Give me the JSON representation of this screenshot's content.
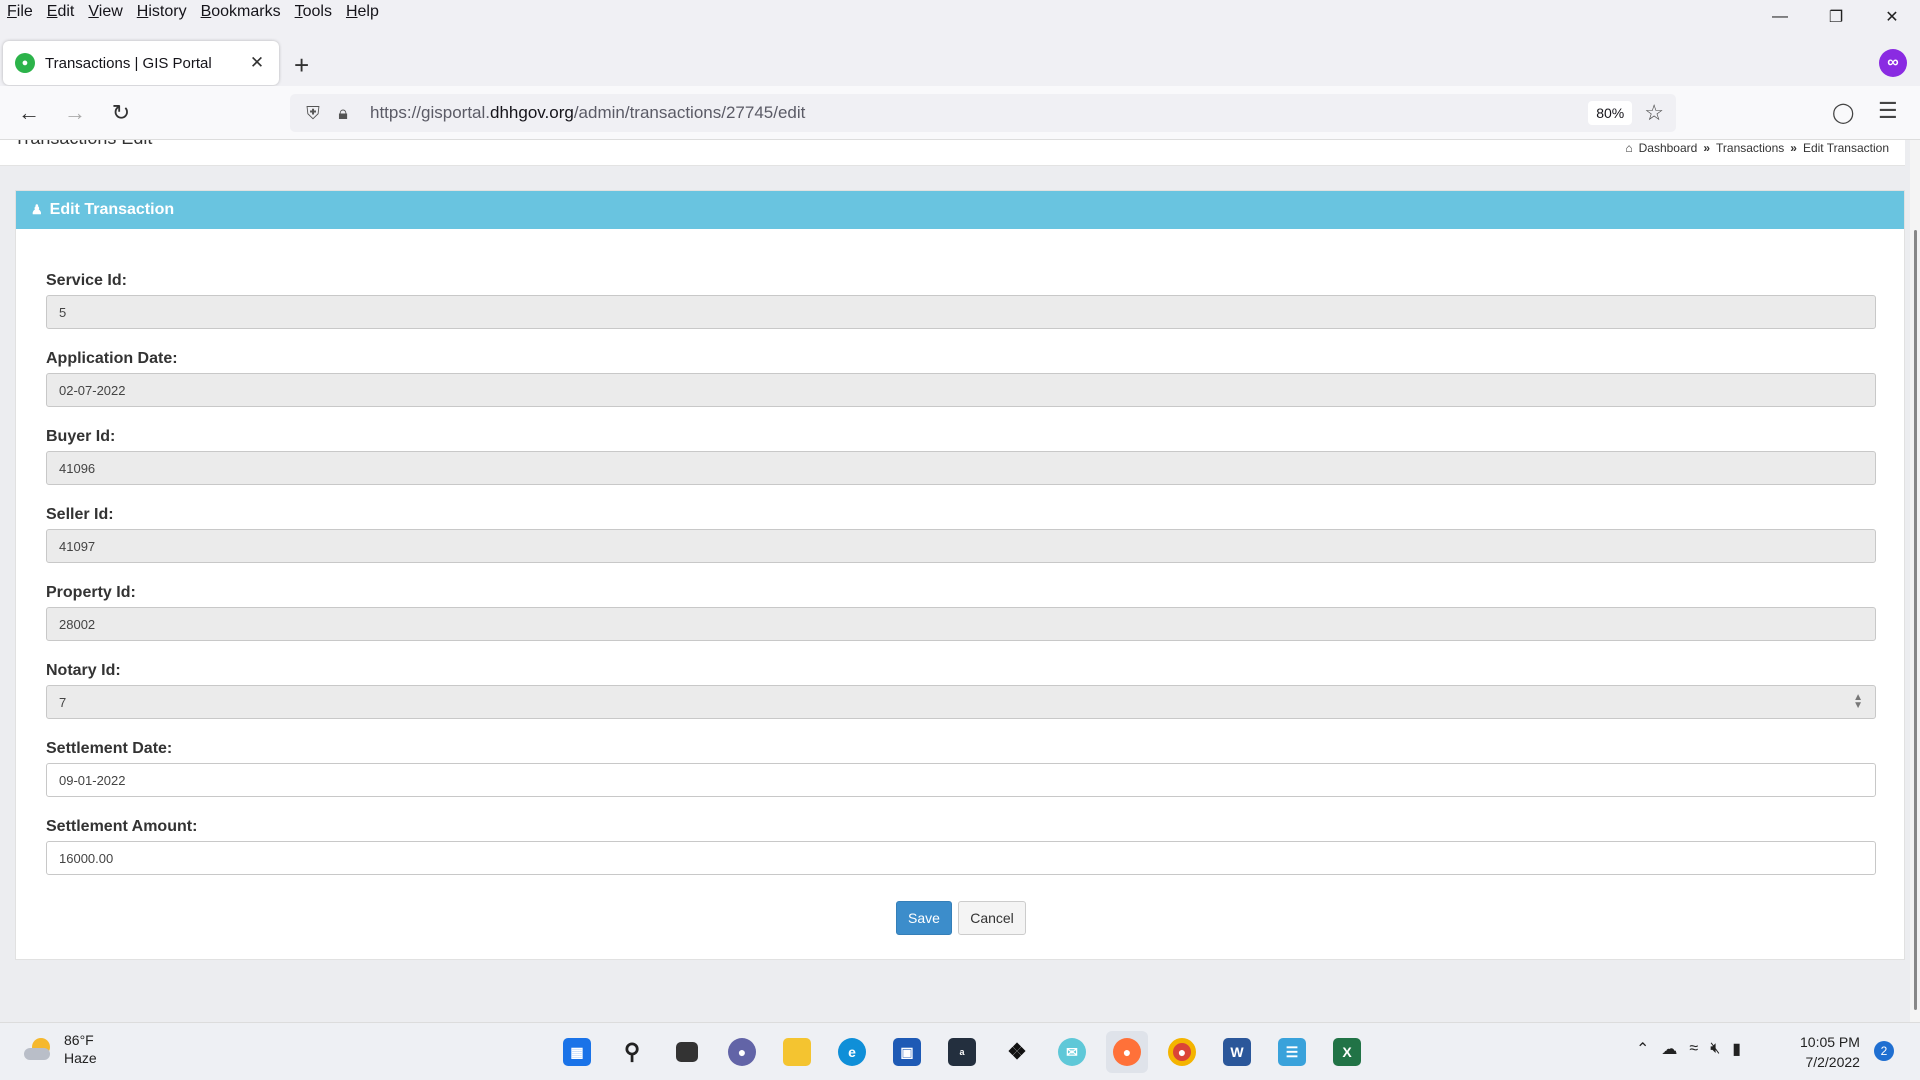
{
  "menubar": {
    "items": [
      "File",
      "Edit",
      "View",
      "History",
      "Bookmarks",
      "Tools",
      "Help"
    ]
  },
  "tab": {
    "title": "Transactions | GIS Portal"
  },
  "url": {
    "prefix": "https://gisportal.",
    "host": "dhhgov.org",
    "path": "/admin/transactions/27745/edit",
    "zoom": "80%"
  },
  "page": {
    "heading": "Transactions Edit",
    "breadcrumb": [
      "Dashboard",
      "Transactions",
      "Edit Transaction"
    ],
    "breadcrumb_sep": "»"
  },
  "panel": {
    "title": "Edit Transaction"
  },
  "form": {
    "fields": [
      {
        "label": "Service Id:",
        "value": "5"
      },
      {
        "label": "Application Date:",
        "value": "02-07-2022"
      },
      {
        "label": "Buyer Id:",
        "value": "41096"
      },
      {
        "label": "Seller Id:",
        "value": "41097"
      },
      {
        "label": "Property Id:",
        "value": "28002"
      },
      {
        "label": "Notary Id:",
        "value": "7"
      },
      {
        "label": "Settlement Date:",
        "value": "09-01-2022"
      },
      {
        "label": "Settlement Amount:",
        "value": "16000.00"
      }
    ],
    "save_label": "Save",
    "cancel_label": "Cancel"
  },
  "taskbar": {
    "weather_temp": "86°F",
    "weather_desc": "Haze",
    "time": "10:05 PM",
    "date": "7/2/2022",
    "notifications": "2",
    "apps": [
      "windows-start-icon",
      "search-icon",
      "task-view-icon",
      "teams-chat-icon",
      "file-explorer-icon",
      "edge-icon",
      "store-icon",
      "amazon-icon",
      "dropbox-icon",
      "mail-icon",
      "firefox-icon",
      "chrome-icon",
      "word-icon",
      "notepad-icon",
      "excel-icon"
    ]
  },
  "colors": {
    "panel_header": "#69c4e0",
    "save_button": "#3c8dcb",
    "account_icon": "#8a2be2"
  }
}
